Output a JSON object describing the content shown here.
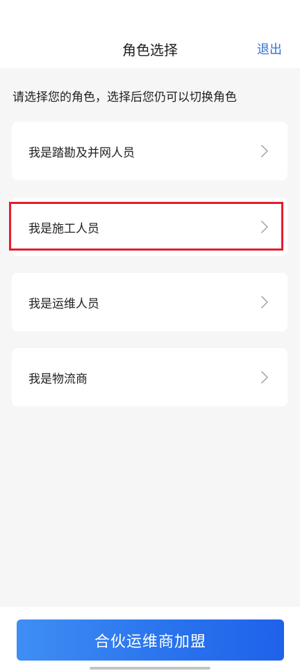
{
  "header": {
    "title": "角色选择",
    "logout_label": "退出"
  },
  "hint": "请选择您的角色，选择后您仍可以切换角色",
  "roles": [
    {
      "label": "我是踏勘及并网人员"
    },
    {
      "label": "我是施工人员"
    },
    {
      "label": "我是运维人员"
    },
    {
      "label": "我是物流商"
    }
  ],
  "selected_role_index": 1,
  "join_button_label": "合伙运维商加盟",
  "colors": {
    "accent": "#2f73d8",
    "highlight": "#e11d2c",
    "button_gradient_start": "#3f8ef4",
    "button_gradient_end": "#1e62ea",
    "background": "#f6f6f6"
  },
  "icons": [
    "chevron-right-icon"
  ]
}
